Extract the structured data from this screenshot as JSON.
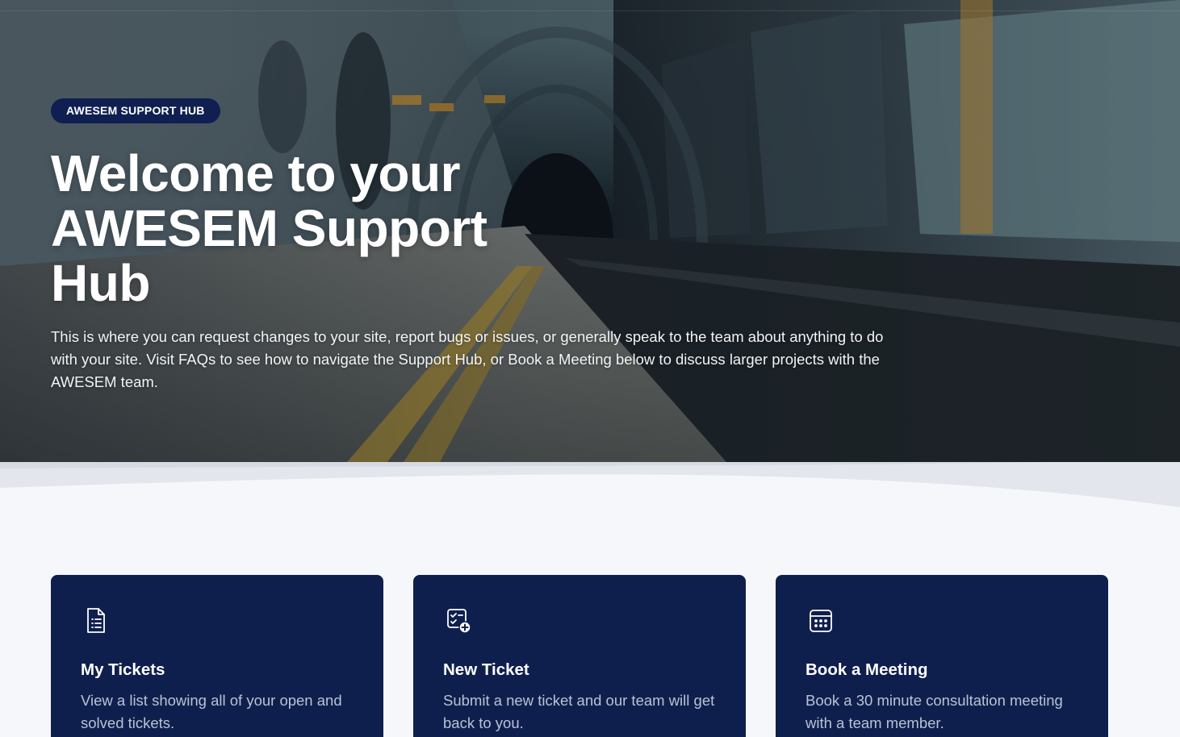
{
  "hero": {
    "badge": "AWESEM SUPPORT HUB",
    "title": "Welcome to your AWESEM Support Hub",
    "description": "This is where you can request changes to your site, report bugs or issues, or generally speak to the team about anything to do with your site. Visit FAQs to see how to navigate the Support Hub, or Book a Meeting below to discuss larger projects with the AWESEM team."
  },
  "cards": [
    {
      "icon": "document-list-icon",
      "title": "My Tickets",
      "description": "View a list showing all of your open and solved tickets."
    },
    {
      "icon": "ticket-add-icon",
      "title": "New Ticket",
      "description": "Submit a new ticket and our team will get back to you."
    },
    {
      "icon": "calendar-icon",
      "title": "Book a Meeting",
      "description": "Book a 30 minute consultation meeting with a team member."
    }
  ],
  "colors": {
    "card_background": "#0f1f4d",
    "badge_background": "#0f1f52",
    "page_background": "#f6f7fa",
    "card_text_muted": "#b9c2d6"
  }
}
